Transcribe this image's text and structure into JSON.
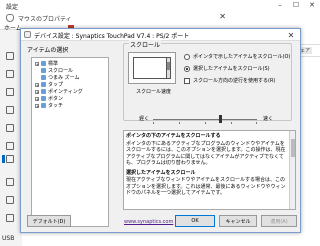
{
  "background": {
    "title": "設定",
    "mouse_window_title": "マウスのプロパティ",
    "left_label": "ホーム",
    "usb_label": "USB",
    "tab_label": "ハードウェア",
    "accent_color": "#0067c0"
  },
  "dialog": {
    "title": "デバイス設定 : Synaptics TouchPad V7.4 : PS/2 ポート",
    "tree_group_label": "アイテムの選択",
    "tree_items": [
      {
        "label": "標準",
        "toggle": "+"
      },
      {
        "label": "スクロール",
        "toggle": ""
      },
      {
        "label": "つまみ ズーム",
        "toggle": ""
      },
      {
        "label": "タップ",
        "toggle": "+"
      },
      {
        "label": "ポインティング",
        "toggle": "+"
      },
      {
        "label": "ボタン",
        "toggle": "+"
      },
      {
        "label": "タッチ",
        "toggle": "+"
      }
    ],
    "scroll_group_label": "スクロール",
    "scroll_speed_label": "スクロール速度",
    "radio_pointer": "ポインタで示したアイテムをスクロール(O)",
    "radio_selected": "選択したアイテムをスクロール(S)",
    "checkbox_reverse": "スクロール方向の逆行を使用する(R)",
    "slider_slow": "遅く",
    "slider_fast": "速く",
    "desc_heading_1": "ポインタの下のアイテムをスクロールする",
    "desc_text_1": "ポインタの下にあるアクティブなプログラムのウィンドウやアイテムをスクロールするには、このオプションを選択します。この操作は、現在アクティブなプログラムに関してはなくアイテムがアクティブでなくても、プログラムは切り替わりません。",
    "desc_heading_2": "選択したアイテムをスクロール",
    "desc_text_2": "現在アクティブなウィンドウやアイテムをスクロールする場合は、このオプションを選択します。これは通常、最後にあるウィンドウやウィンドウのパネルを一つ選択してアイテムです。",
    "defaults_button": "デフォルト(D)",
    "link_text": "www.synaptics.com",
    "ok_button": "OK",
    "cancel_button": "キャンセル",
    "apply_button": "適用(A)"
  }
}
